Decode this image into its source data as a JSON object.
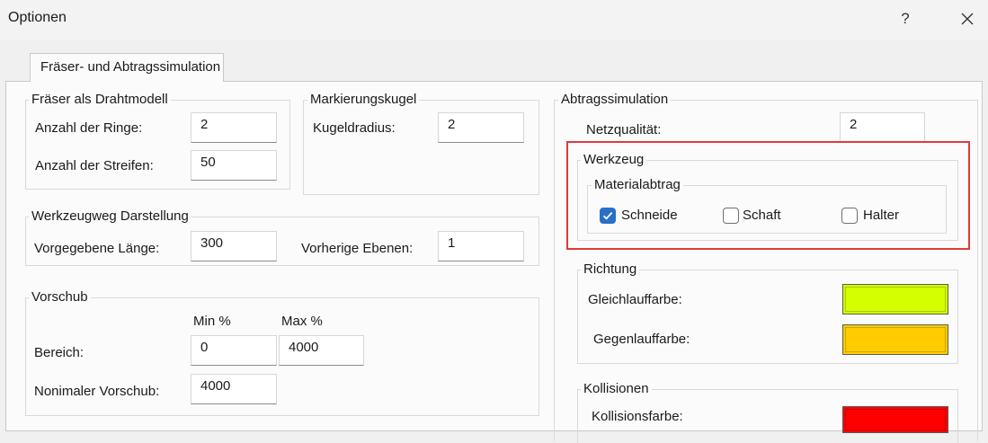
{
  "window": {
    "title": "Optionen",
    "help_label": "?",
    "close_label": "✕"
  },
  "tabs": [
    {
      "label": "Fräser- und Abtragssimulation"
    }
  ],
  "fraeser": {
    "title": "Fräser als Drahtmodell",
    "ringe_label": "Anzahl der Ringe:",
    "ringe_value": "2",
    "streifen_label": "Anzahl der Streifen:",
    "streifen_value": "50"
  },
  "kugel": {
    "title": "Markierungskugel",
    "radius_label": "Kugeldradius:",
    "radius_value": "2"
  },
  "werkzeugweg": {
    "title": "Werkzeugweg Darstellung",
    "laenge_label": "Vorgegebene Länge:",
    "laenge_value": "300",
    "ebenen_label": "Vorherige Ebenen:",
    "ebenen_value": "1"
  },
  "vorschub": {
    "title": "Vorschub",
    "min_header": "Min %",
    "max_header": "Max %",
    "bereich_label": "Bereich:",
    "min_value": "0",
    "max_value": "4000",
    "nominal_label": "Nonimaler Vorschub:",
    "nominal_value": "4000"
  },
  "abtrag": {
    "title": "Abtragssimulation",
    "netz_label": "Netzqualität:",
    "netz_value": "2",
    "werkzeug": {
      "title": "Werkzeug",
      "material": {
        "title": "Materialabtrag",
        "options": [
          {
            "label": "Schneide",
            "checked": true
          },
          {
            "label": "Schaft",
            "checked": false
          },
          {
            "label": "Halter",
            "checked": false
          }
        ]
      }
    },
    "richtung": {
      "title": "Richtung",
      "gleich_label": "Gleichlauffarbe:",
      "gleich_color": "#d4ff00",
      "gegen_label": "Gegenlauffarbe:",
      "gegen_color": "#ffcc00"
    },
    "kollision": {
      "title": "Kollisionen",
      "farbe_label": "Kollisionsfarbe:",
      "farbe_color": "#ff0000"
    }
  },
  "colors": {
    "checkbox_checked": "#2a6fc9",
    "highlight": "#e03a3a"
  }
}
